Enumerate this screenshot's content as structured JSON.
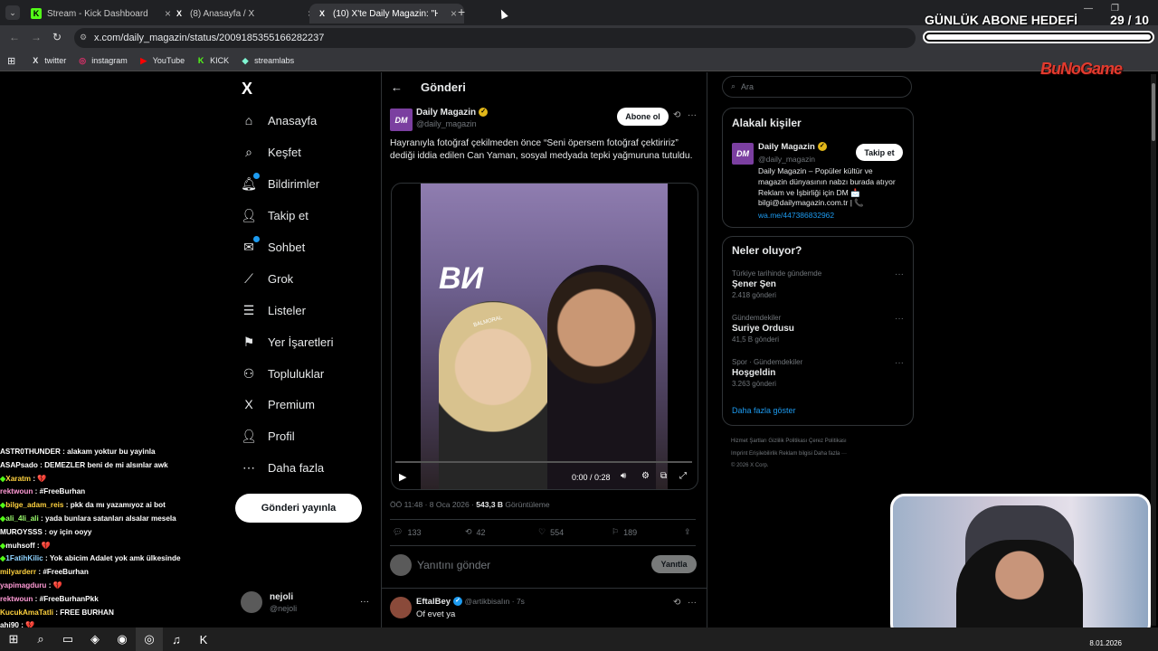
{
  "browser": {
    "tabs": [
      {
        "title": "Stream - Kick Dashboard",
        "favicon": "K"
      },
      {
        "title": "(8) Anasayfa / X",
        "favicon": "X"
      },
      {
        "title": "(10) X'te Daily Magazin: \"Hayra",
        "favicon": "X"
      }
    ],
    "new_tab": "+",
    "url": "x.com/daily_magazin/status/2009185355166282237",
    "bookmarks": [
      {
        "label": "twitter",
        "icon": "X",
        "color": "#000000"
      },
      {
        "label": "instagram",
        "icon": "◎",
        "color": "#e1306c"
      },
      {
        "label": "YouTube",
        "icon": "▶",
        "color": "#ff0000"
      },
      {
        "label": "KICK",
        "icon": "K",
        "color": "#53fc18"
      },
      {
        "label": "streamlabs",
        "icon": "◆",
        "color": "#80f5d2"
      }
    ]
  },
  "overlay": {
    "goal_title": "GÜNLÜK ABONE HEDEFİ",
    "goal_count": "29  / 10",
    "goal_progress": 1.0,
    "brand": "BuNoGame"
  },
  "nav": {
    "logo": "X",
    "items": [
      {
        "label": "Anasayfa",
        "icon": "home-icon",
        "glyph": "⌂",
        "badge": false
      },
      {
        "label": "Keşfet",
        "icon": "search-icon",
        "glyph": "⌕",
        "badge": false
      },
      {
        "label": "Bildirimler",
        "icon": "bell-icon",
        "glyph": "🔔︎",
        "badge": true
      },
      {
        "label": "Takip et",
        "icon": "follow-icon",
        "glyph": "👤︎",
        "badge": false
      },
      {
        "label": "Sohbet",
        "icon": "mail-icon",
        "glyph": "✉",
        "badge": true
      },
      {
        "label": "Grok",
        "icon": "grok-icon",
        "glyph": "⟋",
        "badge": false
      },
      {
        "label": "Listeler",
        "icon": "list-icon",
        "glyph": "☰",
        "badge": false
      },
      {
        "label": "Yer İşaretleri",
        "icon": "bookmark-icon",
        "glyph": "⚑",
        "badge": false
      },
      {
        "label": "Topluluklar",
        "icon": "communities-icon",
        "glyph": "⚇",
        "badge": false
      },
      {
        "label": "Premium",
        "icon": "premium-icon",
        "glyph": "X",
        "badge": false
      },
      {
        "label": "Profil",
        "icon": "profile-icon",
        "glyph": "👤︎",
        "badge": false
      },
      {
        "label": "Daha fazla",
        "icon": "more-icon",
        "glyph": "⋯",
        "badge": false
      }
    ],
    "post_button": "Gönderi yayınla",
    "account_name": "nejoli",
    "account_handle": "@nejoli",
    "account_more": "···"
  },
  "post": {
    "header": "Gönderi",
    "author_name": "Daily Magazin",
    "author_handle": "@daily_magazin",
    "avatar_text": "DM",
    "subscribe": "Abone ol",
    "more": "···",
    "text": "Hayranıyla fotoğraf çekilmeden önce “Seni öpersem fotoğraf çektiririz” dediği iddia edilen Can Yaman, sosyal medyada tepki yağmuruna tutuldu.",
    "video_sign": "ВИ",
    "video_cap": "BALMORAL",
    "video_time": "0:00 / 0:28",
    "time": "ÖÖ 11:48 · 8 Oca 2026 · ",
    "views": "543,3 B",
    "views_label": " Görüntüleme",
    "replies": "133",
    "reposts": "42",
    "likes": "554",
    "bookmarks": "189",
    "reply_placeholder": "Yanıtını gönder",
    "reply_button": "Yanıtla",
    "reply_author": "EftalBey",
    "reply_handle": "@artikbisaIın · 7s",
    "reply_text": "Of evet ya"
  },
  "sidebar": {
    "search_placeholder": "Ara",
    "related_title": "Alakalı kişiler",
    "related_name": "Daily Magazin",
    "related_handle": "@daily_magazin",
    "follow_button": "Takip et",
    "related_bio": "Daily Magazin – Popüler kültür ve magazin dünyasının nabzı burada atıyor Reklam ve İşbirliği için DM 📩 bilgi@dailymagazin.com.tr | 📞",
    "related_link": "wa.me/447386832962",
    "trends_title": "Neler oluyor?",
    "trends": [
      {
        "meta": "Türkiye tarihinde gündemde",
        "name": "Şener Şen",
        "count": "2.418 gönderi"
      },
      {
        "meta": "Gündemdekiler",
        "name": "Suriye Ordusu",
        "count": "41,5 B gönderi"
      },
      {
        "meta": "Spor · Gündemdekiler",
        "name": "Hoşgeldin",
        "count": "3.263 gönderi"
      }
    ],
    "show_more": "Daha fazla göster",
    "footer1": "Hizmet Şartları    Gizlilik Politikası    Çerez Politikası",
    "footer2": "Imprint    Erişilebilirlik    Reklam bilgisi    Daha fazla ···",
    "footer3": "© 2026 X Corp."
  },
  "chat": [
    {
      "user": "ASTR0THUNDER",
      "msg": " : alakam yoktur bu yayinla",
      "color": "#ffffff",
      "badge": ""
    },
    {
      "user": "ASAPsado",
      "msg": " : DEMEZLER beni de mi alsınlar awk",
      "color": "#ffffff",
      "badge": ""
    },
    {
      "user": "Xaratm",
      "msg": " : 💔",
      "color": "#ffd23f",
      "badge": "◆"
    },
    {
      "user": "rektwoun",
      "msg": " : #FreeBurhan",
      "color": "#ff9ad5",
      "badge": ""
    },
    {
      "user": "bilge_adam_reis",
      "msg": " : pkk da mı yazamıyoz ai bot",
      "color": "#ffd23f",
      "badge": "◆"
    },
    {
      "user": "ali_4li_ali",
      "msg": " : yada bunlara satanları alsalar mesela",
      "color": "#9dff6e",
      "badge": "◆"
    },
    {
      "user": "MUROYSSS",
      "msg": " : oy için ooyy",
      "color": "#ffffff",
      "badge": ""
    },
    {
      "user": "muhsoff",
      "msg": " : 💔",
      "color": "#ffffff",
      "badge": "◆"
    },
    {
      "user": "1FatihKilic",
      "msg": " : Yok abicim Adalet yok amk ülkesinde",
      "color": "#8fd3ff",
      "badge": "◆"
    },
    {
      "user": "milyarderr",
      "msg": " : #FreeBurhan",
      "color": "#ffd23f",
      "badge": ""
    },
    {
      "user": "yapimagduru",
      "msg": " : 💔",
      "color": "#ff9ad5",
      "badge": ""
    },
    {
      "user": "rektwoun",
      "msg": " : #FreeBurhanPkk",
      "color": "#ff9ad5",
      "badge": ""
    },
    {
      "user": "KucukAmaTatli",
      "msg": " : FREE BURHAN",
      "color": "#ffd23f",
      "badge": ""
    },
    {
      "user": "ahi90",
      "msg": " : 💔",
      "color": "#ffffff",
      "badge": ""
    }
  ],
  "taskbar": {
    "icons": [
      "windows-icon",
      "search-icon",
      "folder-icon",
      "app-icon",
      "discord-icon",
      "chrome-icon",
      "spotify-icon",
      "kick-icon"
    ],
    "glyphs": [
      "⊞",
      "⌕",
      "▭",
      "◈",
      "◉",
      "◎",
      "♫",
      "K"
    ],
    "date": "8.01.2026"
  }
}
